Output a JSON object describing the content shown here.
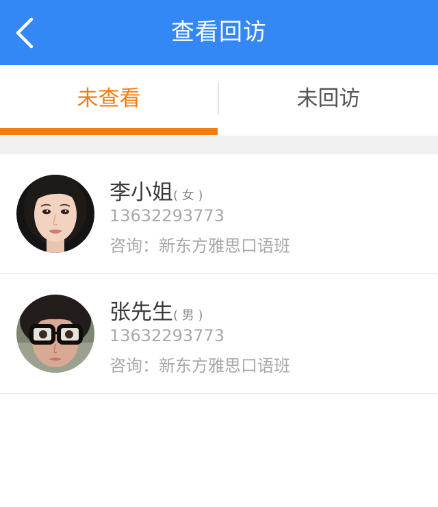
{
  "header": {
    "title": "查看回访",
    "back_icon": "back-arrow-icon",
    "background_color": "#3388f5"
  },
  "tabs": [
    {
      "label": "未查看",
      "active": true,
      "color": "#f47d0c"
    },
    {
      "label": "未回访",
      "active": false,
      "color": "#555555"
    }
  ],
  "contacts": [
    {
      "name": "李小姐",
      "gender": "( 女 )",
      "phone": "13632293773",
      "consult": "咨询：新东方雅思口语班",
      "avatar_icon": "woman-portrait-avatar"
    },
    {
      "name": "张先生",
      "gender": "( 男 )",
      "phone": "13632293773",
      "consult": "咨询：新东方雅思口语班",
      "avatar_icon": "glasses-portrait-avatar"
    }
  ]
}
